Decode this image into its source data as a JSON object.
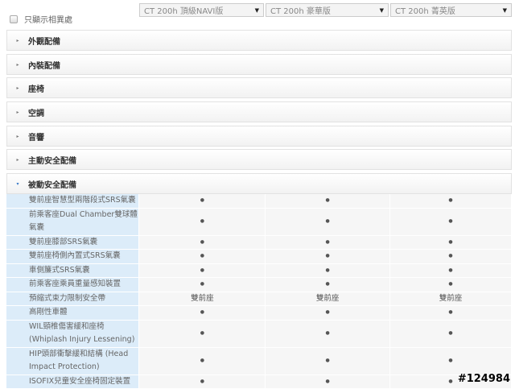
{
  "filter": {
    "show_diff_label": "只顯示相異處"
  },
  "models": [
    "CT 200h 頂級NAVI版",
    "CT 200h 豪華版",
    "CT 200h 菁英版"
  ],
  "dropdown_arrow": "▼",
  "sections": [
    {
      "label": "外觀配備",
      "expanded": false
    },
    {
      "label": "內裝配備",
      "expanded": false
    },
    {
      "label": "座椅",
      "expanded": false
    },
    {
      "label": "空調",
      "expanded": false
    },
    {
      "label": "音響",
      "expanded": false
    },
    {
      "label": "主動安全配備",
      "expanded": false
    },
    {
      "label": "被動安全配備",
      "expanded": true
    }
  ],
  "icons": {
    "collapsed": "▸",
    "expanded": "▾"
  },
  "rows": [
    {
      "label": "雙前座智慧型兩階段式SRS氣囊",
      "values": [
        "●",
        "●",
        "●"
      ]
    },
    {
      "label": "前乘客座Dual Chamber雙球體氣囊",
      "values": [
        "●",
        "●",
        "●"
      ]
    },
    {
      "label": "雙前座膝部SRS氣囊",
      "values": [
        "●",
        "●",
        "●"
      ]
    },
    {
      "label": "雙前座椅側內置式SRS氣囊",
      "values": [
        "●",
        "●",
        "●"
      ]
    },
    {
      "label": "車側簾式SRS氣囊",
      "values": [
        "●",
        "●",
        "●"
      ]
    },
    {
      "label": "前乘客座乘員重量感知裝置",
      "values": [
        "●",
        "●",
        "●"
      ]
    },
    {
      "label": "預縮式束力限制安全帶",
      "values": [
        "雙前座",
        "雙前座",
        "雙前座"
      ]
    },
    {
      "label": "高剛性車體",
      "values": [
        "●",
        "●",
        "●"
      ]
    },
    {
      "label": "WIL頸椎傷害緩和座椅 (Whiplash Injury Lessening)",
      "values": [
        "●",
        "●",
        "●"
      ]
    },
    {
      "label": "HIP頭部衝擊緩和結構 (Head Impact Protection)",
      "values": [
        "●",
        "●",
        "●"
      ]
    },
    {
      "label": "ISOFIX兒童安全座椅固定裝置",
      "values": [
        "●",
        "●",
        "●"
      ]
    }
  ],
  "watermark": "#124984"
}
